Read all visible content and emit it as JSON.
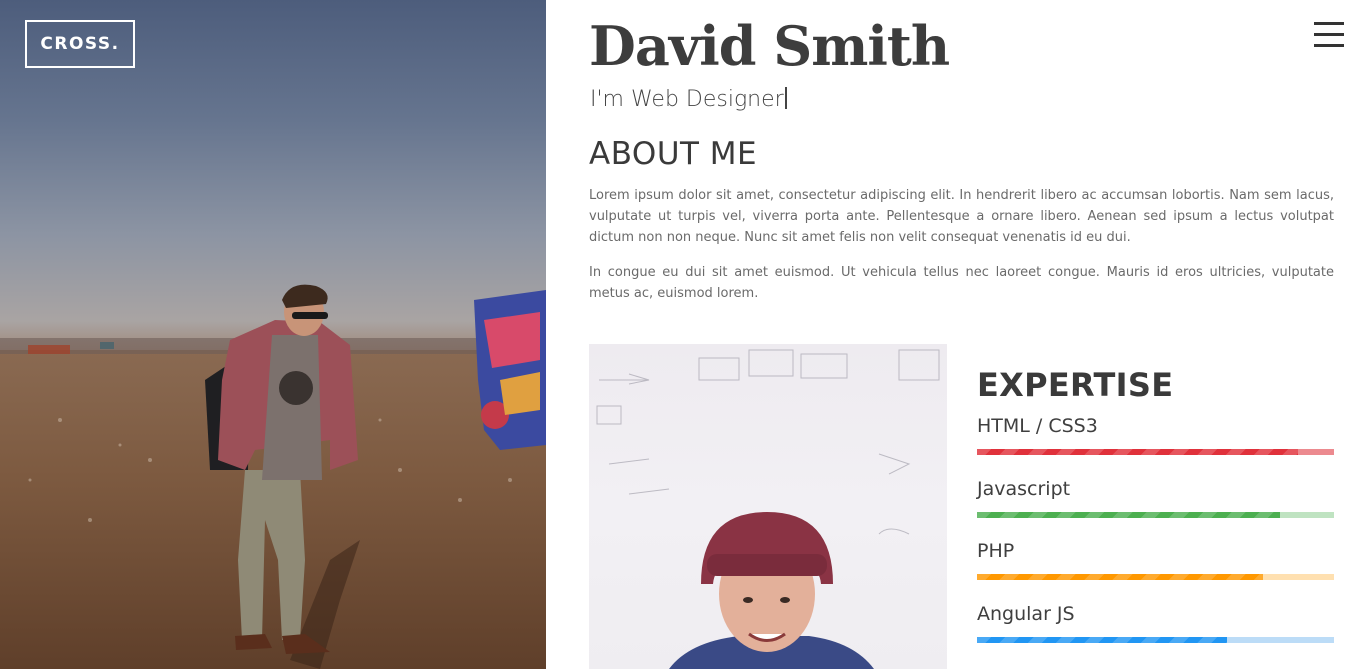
{
  "header": {
    "logo_text": "CROSS.",
    "menu_icon": "hamburger-menu-icon"
  },
  "profile": {
    "name": "David Smith",
    "tagline": "I'm Web Designer"
  },
  "about": {
    "title": "ABOUT ME",
    "paragraphs": [
      "Lorem ipsum dolor sit amet, consectetur adipiscing elit. In hendrerit libero ac accumsan lobortis. Nam sem lacus, vulputate ut turpis vel, viverra porta ante. Pellentesque a ornare libero. Aenean sed ipsum a lectus volutpat dictum non non neque. Nunc sit amet felis non velit consequat venenatis id eu dui.",
      "In congue eu dui sit amet euismod. Ut vehicula tellus nec laoreet congue. Mauris id eros ultricies, vulputate metus ac, euismod lorem."
    ]
  },
  "expertise": {
    "title": "EXPERTISE",
    "skills": [
      {
        "label": "HTML / CSS3",
        "level": 0.9,
        "color": "#e0313b",
        "track_color": "#ec8a8f"
      },
      {
        "label": "Javascript",
        "level": 0.85,
        "color": "#4caf50",
        "track_color": "#bfe3c1"
      },
      {
        "label": "PHP",
        "level": 0.8,
        "color": "#ff9800",
        "track_color": "#ffe0b0"
      },
      {
        "label": "Angular JS",
        "level": 0.7,
        "color": "#2196f3",
        "track_color": "#bcdcf7"
      }
    ]
  },
  "colors": {
    "text_dark": "#3d3d3d",
    "text_body": "#6a6a6a",
    "logo_border": "#ffffff"
  }
}
